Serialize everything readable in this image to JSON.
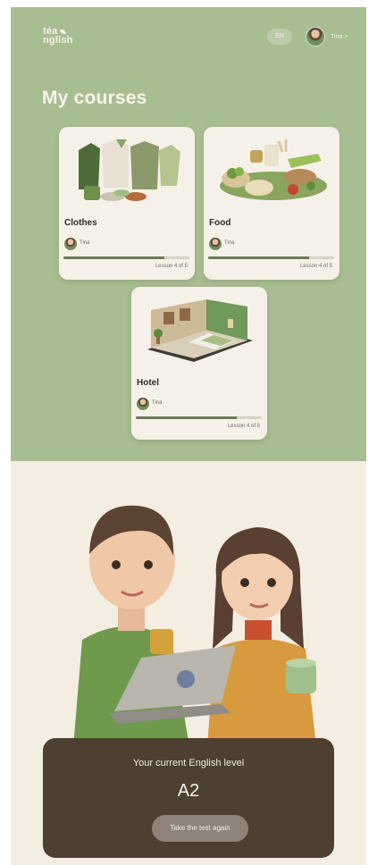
{
  "header": {
    "logo_line1": "téa",
    "logo_line2": "nglish",
    "language_button": "EN",
    "user_name": "Tina >"
  },
  "courses": {
    "title": "My courses",
    "items": [
      {
        "name": "Clothes",
        "author": "Tina",
        "lesson": "Lesson 4 of 5",
        "progress": 0.8
      },
      {
        "name": "Food",
        "author": "Tina",
        "lesson": "Lesson 4 of 5",
        "progress": 0.8
      },
      {
        "name": "Hotel",
        "author": "Tina",
        "lesson": "Lesson 4 of 5",
        "progress": 0.8
      }
    ]
  },
  "level": {
    "label": "Your current English level",
    "value": "A2",
    "retake_label": "Take the test again"
  },
  "colors": {
    "top_bg": "#a9bd93",
    "bottom_bg": "#f4ede2",
    "level_box": "#4e3f33",
    "progress_fill": "#6b7c58"
  }
}
